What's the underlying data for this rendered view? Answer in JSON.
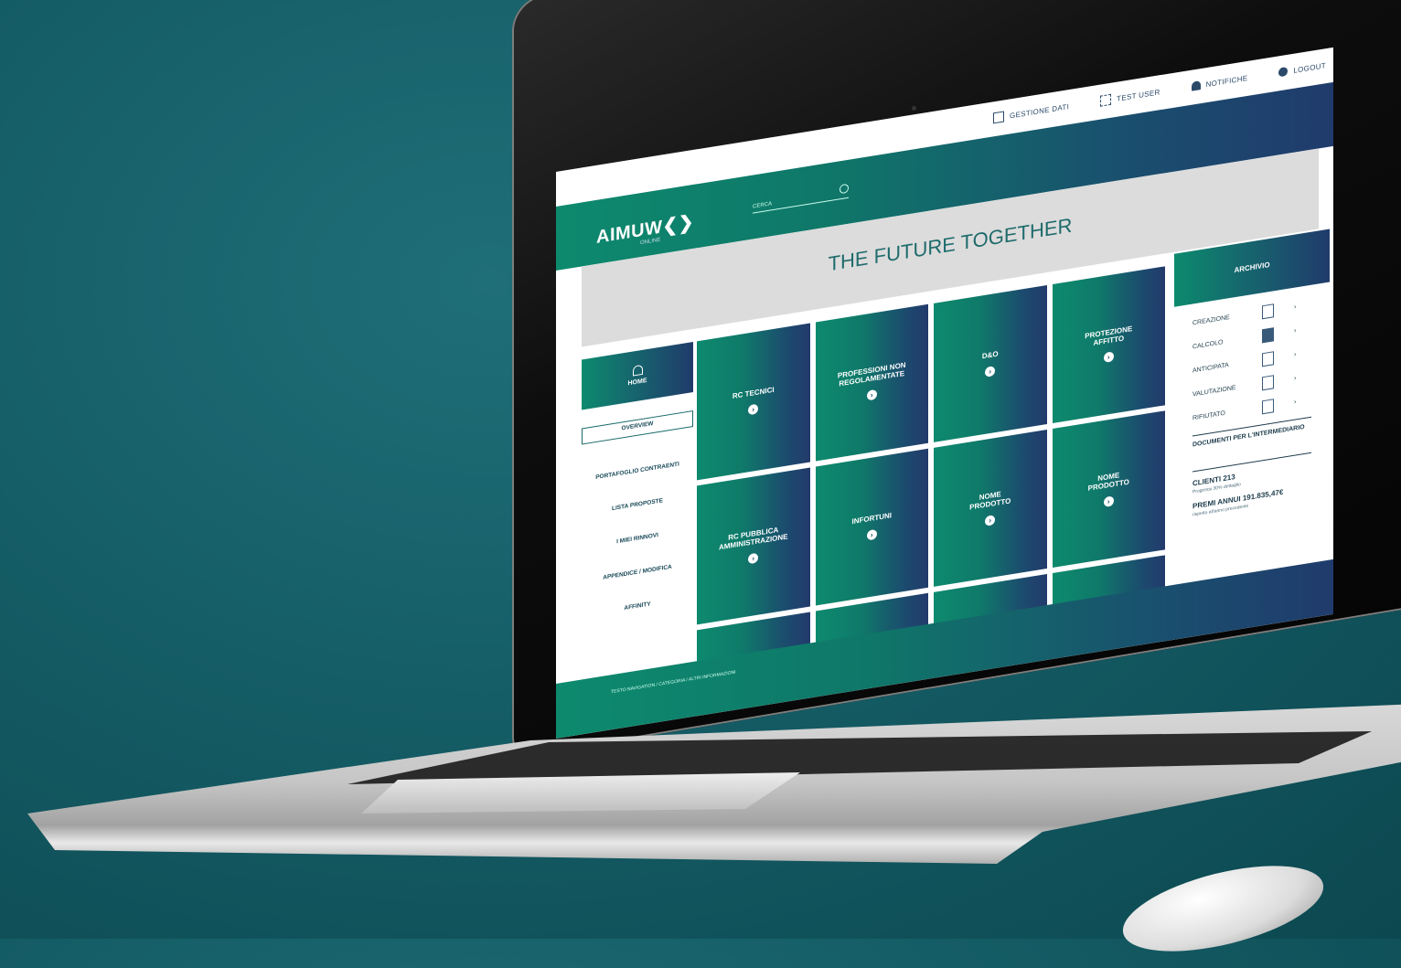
{
  "top_nav": [
    {
      "label": "GESTIONE DATI",
      "icon": "folder-icon"
    },
    {
      "label": "TEST USER",
      "icon": "users-icon"
    },
    {
      "label": "NOTIFICHE",
      "icon": "bell-icon"
    },
    {
      "label": "LOGOUT",
      "icon": "user-logout-icon"
    }
  ],
  "brand": {
    "logo": "AIMUW",
    "logo_mark": "❮❯",
    "sub": "ONLINE"
  },
  "search": {
    "placeholder": "CERCA"
  },
  "banner": {
    "title": "THE FUTURE TOGETHER"
  },
  "sidebar": {
    "home_label": "HOME",
    "items": [
      {
        "label": "OVERVIEW",
        "active": true
      },
      {
        "label": "PORTAFOGLIO CONTRAENTI"
      },
      {
        "label": "LISTA PROPOSTE"
      },
      {
        "label": "I MIEI RINNOVI"
      },
      {
        "label": "APPENDICE / MODIFICA"
      },
      {
        "label": "AFFINITY"
      }
    ]
  },
  "tiles": [
    {
      "label": "RC TECNICI"
    },
    {
      "label": "PROFESSIONI NON REGOLAMENTATE"
    },
    {
      "label": "D&O"
    },
    {
      "label": "PROTEZIONE AFFITTO"
    },
    {
      "label": "RC PUBBLICA AMMINISTRAZIONE"
    },
    {
      "label": "INFORTUNI"
    },
    {
      "label": "NOME PRODOTTO"
    },
    {
      "label": "NOME PRODOTTO"
    },
    {
      "label": ""
    },
    {
      "label": ""
    },
    {
      "label": ""
    },
    {
      "label": ""
    }
  ],
  "archive": {
    "title": "ARCHIVIO",
    "rows": [
      {
        "label": "CREAZIONE",
        "icon": "document-icon"
      },
      {
        "label": "CALCOLO",
        "icon": "calculator-icon"
      },
      {
        "label": "ANTICIPATA",
        "icon": "document-icon"
      },
      {
        "label": "VALUTAZIONE",
        "icon": "grid-icon"
      },
      {
        "label": "RIFIUTATO",
        "icon": "document-icon"
      }
    ],
    "documents": "DOCUMENTI PER L'INTERMEDIARIO",
    "clienti": "CLIENTI 213",
    "clienti_sub": "Progressi 30% dettaglio",
    "premi": "PREMI ANNUI 191.835,47€",
    "premi_sub": "rispetto all'anno precedente"
  },
  "footer": {
    "text": "TESTO NAVIGATION / CATEGORIA / ALTRI INFORMAZIONI"
  }
}
